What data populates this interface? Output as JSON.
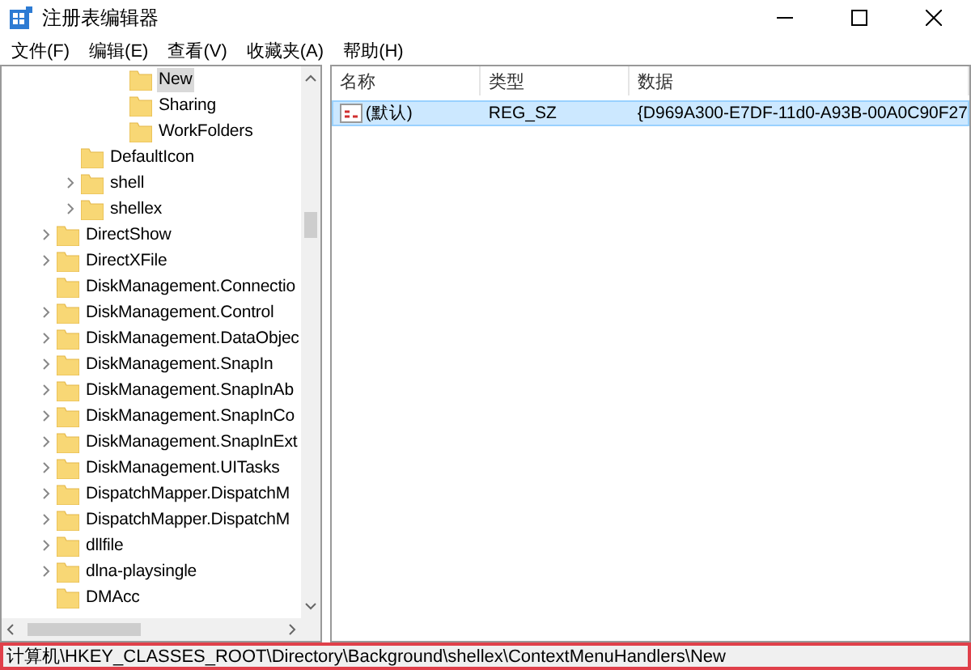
{
  "window": {
    "title": "注册表编辑器"
  },
  "menu": [
    "文件(F)",
    "编辑(E)",
    "查看(V)",
    "收藏夹(A)",
    "帮助(H)"
  ],
  "tree": {
    "items": [
      {
        "children": [
          {
            "children": [
              {
                "children": [
                  {
                    "label": "New",
                    "has_children": false,
                    "selected": true
                  },
                  {
                    "label": "Sharing",
                    "has_children": false,
                    "selected": false
                  },
                  {
                    "label": "WorkFolders",
                    "has_children": false,
                    "selected": false
                  }
                ]
              }
            ]
          },
          {
            "label": "DefaultIcon",
            "has_children": false,
            "selected": false
          },
          {
            "label": "shell",
            "has_children": true,
            "selected": false
          },
          {
            "label": "shellex",
            "has_children": true,
            "selected": false
          }
        ]
      },
      {
        "label": "DirectShow",
        "has_children": true,
        "selected": false
      },
      {
        "label": "DirectXFile",
        "has_children": true,
        "selected": false
      },
      {
        "label": "DiskManagement.Connectio",
        "has_children": false,
        "selected": false
      },
      {
        "label": "DiskManagement.Control",
        "has_children": true,
        "selected": false
      },
      {
        "label": "DiskManagement.DataObjec",
        "has_children": true,
        "selected": false
      },
      {
        "label": "DiskManagement.SnapIn",
        "has_children": true,
        "selected": false
      },
      {
        "label": "DiskManagement.SnapInAb",
        "has_children": true,
        "selected": false
      },
      {
        "label": "DiskManagement.SnapInCo",
        "has_children": true,
        "selected": false
      },
      {
        "label": "DiskManagement.SnapInExt",
        "has_children": true,
        "selected": false
      },
      {
        "label": "DiskManagement.UITasks",
        "has_children": true,
        "selected": false
      },
      {
        "label": "DispatchMapper.DispatchM",
        "has_children": true,
        "selected": false
      },
      {
        "label": "DispatchMapper.DispatchM",
        "has_children": true,
        "selected": false
      },
      {
        "label": "dllfile",
        "has_children": true,
        "selected": false
      },
      {
        "label": "dlna-playsingle",
        "has_children": true,
        "selected": false
      },
      {
        "label": "DMAcc",
        "has_children": false,
        "selected": false
      }
    ]
  },
  "values": {
    "columns": [
      "名称",
      "类型",
      "数据"
    ],
    "rows": [
      {
        "cells": [
          "(默认)",
          "REG_SZ",
          "{D969A300-E7DF-11d0-A93B-00A0C90F27"
        ],
        "selected": true
      }
    ]
  },
  "status_bar": {
    "path": "计算机\\HKEY_CLASSES_ROOT\\Directory\\Background\\shellex\\ContextMenuHandlers\\New",
    "highlighted": true
  }
}
